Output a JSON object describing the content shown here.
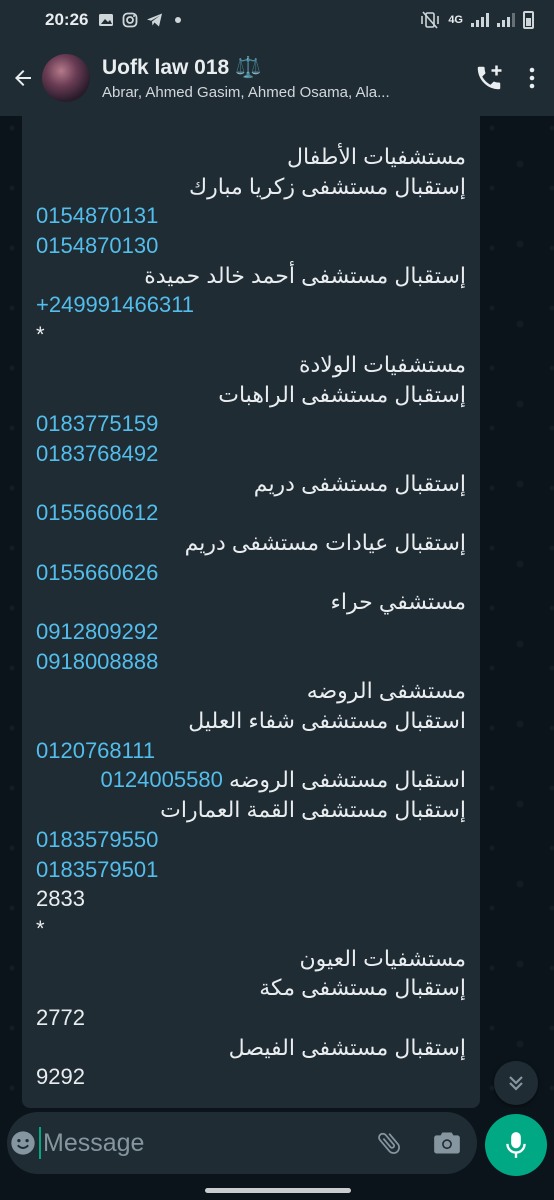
{
  "status_bar": {
    "time": "20:26",
    "network": "4G",
    "notif_icons": [
      "image-icon",
      "instagram-icon",
      "telegram-icon",
      "dot-icon"
    ]
  },
  "header": {
    "group_name": "Uofk law 018 ⚖️",
    "members": "Abrar, Ahmed Gasim, Ahmed Osama, Ala..."
  },
  "message": {
    "lines": [
      {
        "text": "مستشفيات الأطفال",
        "kind": "rtl"
      },
      {
        "text": "إستقبال مستشفى زكريا مبارك",
        "kind": "rtl"
      },
      {
        "text": "0154870131",
        "kind": "link"
      },
      {
        "text": " 0154870130",
        "kind": "link"
      },
      {
        "text": "إستقبال مستشفى أحمد خالد حميدة",
        "kind": "rtl"
      },
      {
        "text": "+249991466311",
        "kind": "link"
      },
      {
        "text": "*",
        "kind": "ltr"
      },
      {
        "text": "مستشفيات الولادة",
        "kind": "rtl"
      },
      {
        "text": "إستقبال مستشفى الراهبات",
        "kind": "rtl"
      },
      {
        "text": "0183775159",
        "kind": "link"
      },
      {
        "text": "0183768492",
        "kind": "link"
      },
      {
        "text": "إستقبال مستشفى دريم",
        "kind": "rtl"
      },
      {
        "text": "0155660612",
        "kind": "link"
      },
      {
        "text": "إستقبال عيادات مستشفى دريم",
        "kind": "rtl"
      },
      {
        "text": "0155660626",
        "kind": "link"
      },
      {
        "text": "مستشفي حراء",
        "kind": "rtl"
      },
      {
        "text": "0912809292",
        "kind": "link"
      },
      {
        "text": "0918008888",
        "kind": "link"
      },
      {
        "text": "مستشفى الروضه",
        "kind": "rtl"
      },
      {
        "text": "استقبال مستشفى شفاء العليل",
        "kind": "rtl"
      },
      {
        "text": "0120768111",
        "kind": "link"
      },
      {
        "text": "استقبال مستشفى الروضه",
        "kind": "mixed",
        "num": "0124005580"
      },
      {
        "text": "إستقبال مستشفى القمة العمارات",
        "kind": "rtl"
      },
      {
        "text": "0183579550",
        "kind": "link"
      },
      {
        "text": "0183579501",
        "kind": "link"
      },
      {
        "text": "2833",
        "kind": "ltr"
      },
      {
        "text": "*",
        "kind": "ltr"
      },
      {
        "text": "مستشفيات العيون",
        "kind": "rtl"
      },
      {
        "text": "إستقبال مستشفى مكة",
        "kind": "rtl"
      },
      {
        "text": "2772",
        "kind": "ltr"
      },
      {
        "text": "إستقبال مستشفى الفيصل",
        "kind": "rtl"
      },
      {
        "text": "9292",
        "kind": "ltr"
      }
    ]
  },
  "input": {
    "placeholder": "Message"
  },
  "colors": {
    "accent": "#00a884",
    "link": "#53bdeb",
    "bubble": "#1f2c34",
    "background": "#0b141a"
  }
}
